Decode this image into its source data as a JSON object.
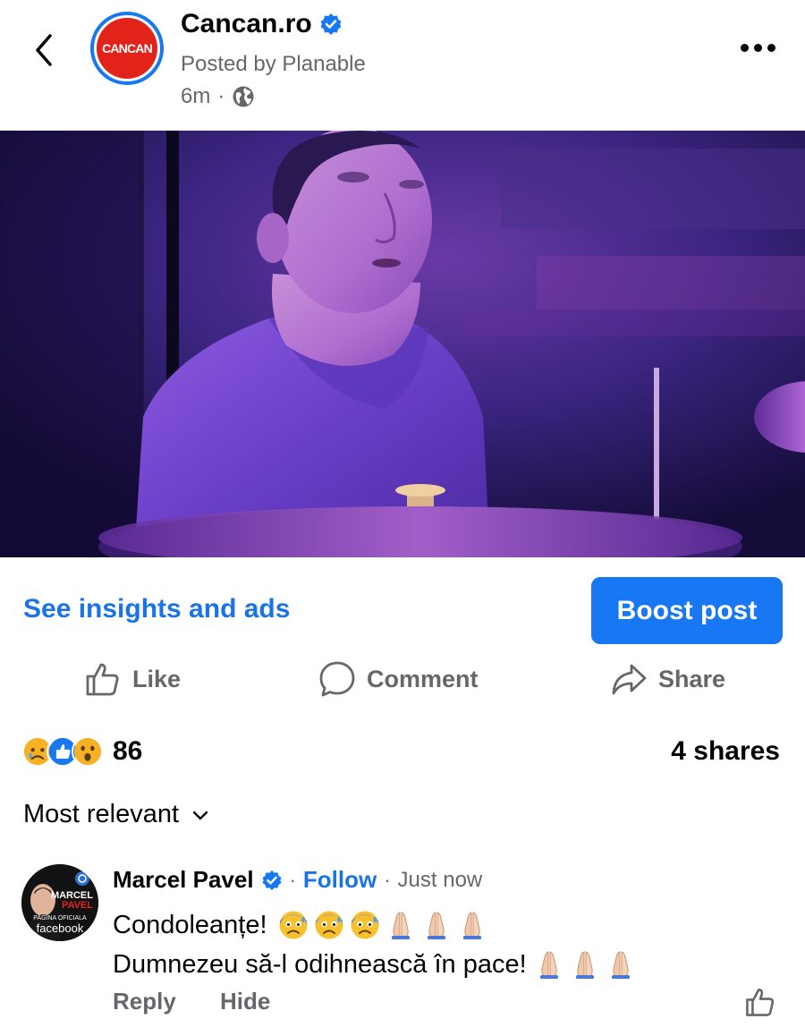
{
  "header": {
    "page_name": "Cancan.ro",
    "logo_text": "CANCAN",
    "posted_by": "Posted by Planable",
    "time": "6m",
    "separator": "·",
    "icons": [
      "back-chevron-icon",
      "verified-badge-icon",
      "globe-icon",
      "more-dots-icon"
    ]
  },
  "photo": {
    "subject": "drummer-on-stage-purple-light"
  },
  "insights": {
    "link_label": "See insights and ads",
    "boost_label": "Boost post",
    "boost_color": "#1877f2"
  },
  "actions": {
    "like": "Like",
    "comment": "Comment",
    "share": "Share"
  },
  "stats": {
    "reactions": [
      "sad",
      "like",
      "wow"
    ],
    "reaction_count": "86",
    "shares": "4 shares"
  },
  "sort": {
    "label": "Most relevant"
  },
  "comment": {
    "author": "Marcel Pavel",
    "avatar_text": [
      "MARCEL",
      "PAVEL",
      "PAGINA OFICIALA",
      "facebook"
    ],
    "separator": "·",
    "follow": "Follow",
    "time": "Just now",
    "line1": "Condoleanțe!",
    "line1_emojis": [
      "anxious-face-with-sweat",
      "anxious-face-with-sweat",
      "anxious-face-with-sweat",
      "folded-hands",
      "folded-hands",
      "folded-hands"
    ],
    "line2": "Dumnezeu să-l odihnească în pace!",
    "line2_emojis": [
      "folded-hands",
      "folded-hands",
      "folded-hands"
    ],
    "reply": "Reply",
    "hide": "Hide"
  },
  "colors": {
    "accent": "#1877f2",
    "link": "#1b74e4",
    "secondary_text": "#65676b",
    "brand_red": "#e2231a"
  }
}
